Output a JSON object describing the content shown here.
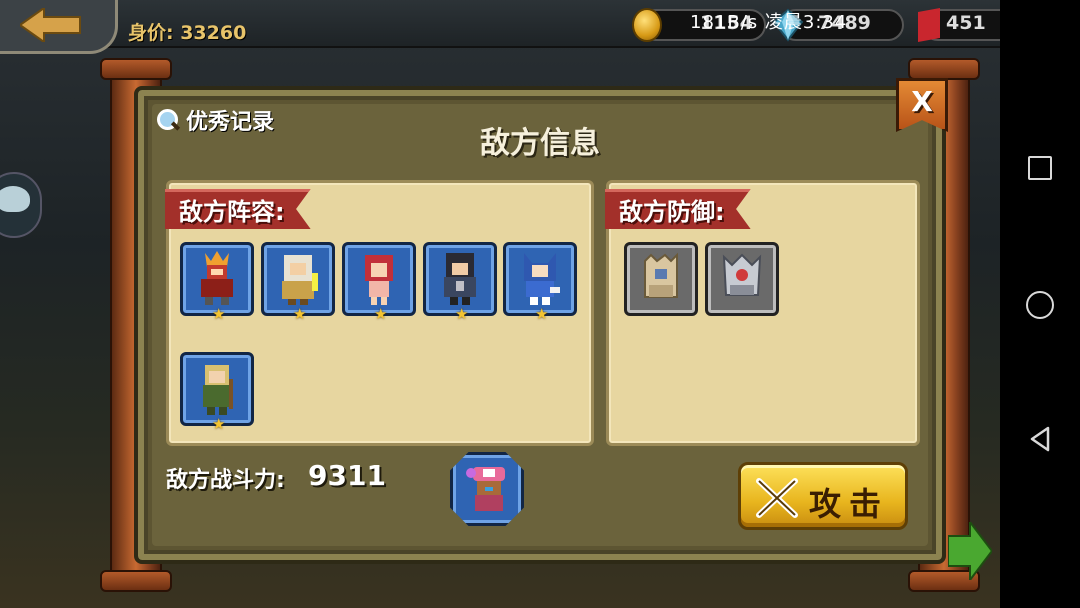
{
  "top_bar": {
    "networth": "身价: 33260",
    "gold": "1154",
    "crystals": "7489",
    "gems": "451",
    "status_text": "181B/s 凌晨3:34"
  },
  "dialog": {
    "title": "敌方信息",
    "record_label": "优秀记录",
    "close_label": "X",
    "lineup_label": "敌方阵容:",
    "defense_label": "敌方防御:",
    "power_label": "敌方战斗力:",
    "power_value": "9311",
    "attack_label": "攻击"
  },
  "lineup": [
    {
      "hero": "red-armored-knight",
      "stars": "★"
    },
    {
      "hero": "white-haired-sage",
      "stars": "★"
    },
    {
      "hero": "red-haired-girl",
      "stars": "★"
    },
    {
      "hero": "dark-haired-swordsman",
      "stars": "★"
    },
    {
      "hero": "blue-fox-hood-hero",
      "stars": "★"
    },
    {
      "hero": "green-elf-archer",
      "stars": "★"
    }
  ],
  "defenses": [
    {
      "unit": "stone-turret-tower"
    },
    {
      "unit": "spiked-mech-tower"
    }
  ],
  "colors": {
    "hero_card": "#2f64b3",
    "defense_card": "#6a6a6a",
    "ribbon": "#a3302a",
    "attack_button": "#f0c02c",
    "panel": "#e7d6a0"
  }
}
